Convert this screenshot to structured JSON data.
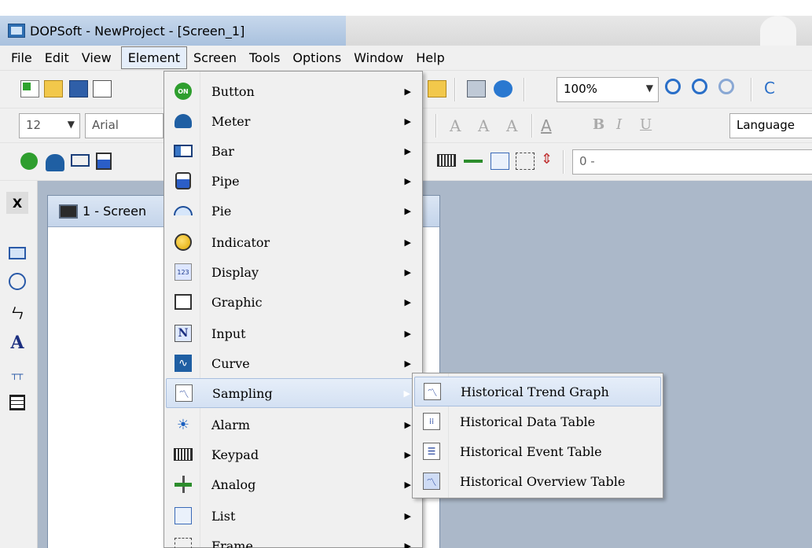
{
  "title_bar": {
    "text": "DOPSoft - NewProject - [Screen_1]"
  },
  "menu_bar": {
    "items": [
      "File",
      "Edit",
      "View",
      "Element",
      "Screen",
      "Tools",
      "Options",
      "Window",
      "Help"
    ],
    "active": "Element"
  },
  "toolbar1": {
    "zoom": "100%"
  },
  "toolbar2": {
    "font_size": "12",
    "font_name": "Arial",
    "language": "Language"
  },
  "toolbar3": {
    "value_field": "0 -"
  },
  "screen_window": {
    "title": "1 - Screen"
  },
  "element_menu": {
    "items": [
      {
        "label": "Button",
        "icon": "button-on-icon"
      },
      {
        "label": "Meter",
        "icon": "meter-icon"
      },
      {
        "label": "Bar",
        "icon": "bar-icon"
      },
      {
        "label": "Pipe",
        "icon": "pipe-icon"
      },
      {
        "label": "Pie",
        "icon": "pie-icon"
      },
      {
        "label": "Indicator",
        "icon": "indicator-icon"
      },
      {
        "label": "Display",
        "icon": "display-icon"
      },
      {
        "label": "Graphic",
        "icon": "graphic-icon"
      },
      {
        "label": "Input",
        "icon": "input-icon"
      },
      {
        "label": "Curve",
        "icon": "curve-icon"
      },
      {
        "label": "Sampling",
        "icon": "sampling-icon"
      },
      {
        "label": "Alarm",
        "icon": "alarm-icon"
      },
      {
        "label": "Keypad",
        "icon": "keypad-icon"
      },
      {
        "label": "Analog",
        "icon": "analog-icon"
      },
      {
        "label": "List",
        "icon": "list-icon"
      },
      {
        "label": "Frame",
        "icon": "frame-icon"
      }
    ],
    "highlighted": "Sampling"
  },
  "sampling_submenu": {
    "items": [
      {
        "label": "Historical Trend Graph",
        "icon": "trend-graph-icon"
      },
      {
        "label": "Historical Data Table",
        "icon": "data-table-icon"
      },
      {
        "label": "Historical Event Table",
        "icon": "event-table-icon"
      },
      {
        "label": "Historical Overview Table",
        "icon": "overview-table-icon"
      }
    ],
    "highlighted": "Historical Trend Graph"
  },
  "colors": {
    "highlight": "#d4e1f3",
    "workspace": "#abb8c9",
    "accent": "#1f5fa3"
  }
}
